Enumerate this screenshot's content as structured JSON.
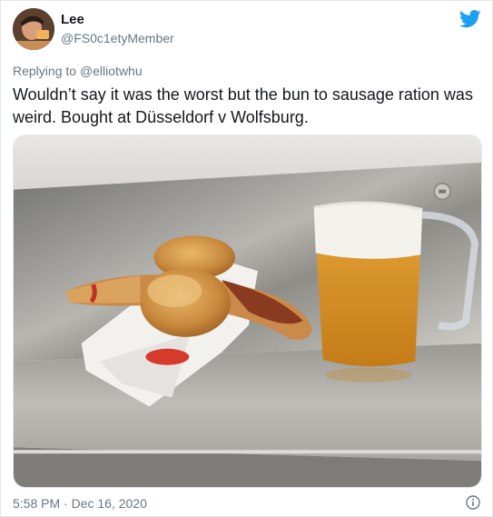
{
  "user": {
    "display_name": "Lee",
    "handle": "@FS0c1etyMember"
  },
  "reply": {
    "prefix": "Replying to",
    "mention": "@elliotwhu"
  },
  "tweet": {
    "text": "Wouldn’t say it was the worst but the bun to sausage ration was weird. Bought at Düsseldorf v Wolfsburg."
  },
  "footer": {
    "timestamp": "5:58 PM · Dec 16, 2020"
  },
  "icons": {
    "brand": "twitter-bird-icon",
    "info": "info-icon"
  },
  "colors": {
    "twitter_blue": "#1da1f2",
    "secondary_text": "#657786",
    "primary_text": "#14171a"
  }
}
